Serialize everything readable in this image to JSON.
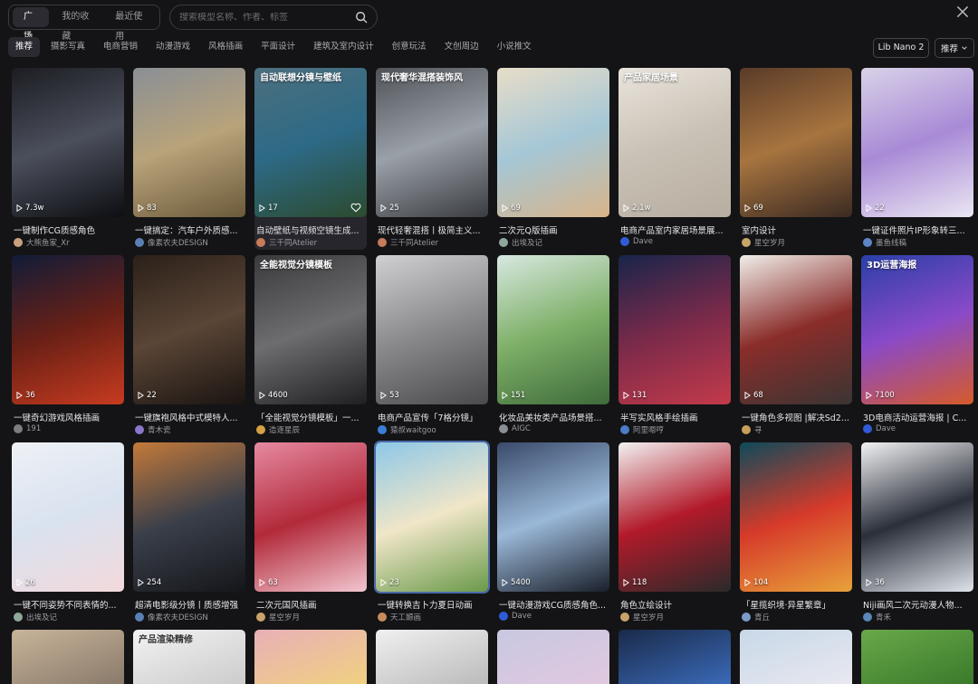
{
  "tabs": [
    {
      "label": "广场",
      "active": true
    },
    {
      "label": "我的收藏",
      "active": false
    },
    {
      "label": "最近使用",
      "active": false
    }
  ],
  "search": {
    "placeholder": "搜索模型名称、作者、标签"
  },
  "categories": [
    {
      "label": "推荐",
      "active": true
    },
    {
      "label": "摄影写真",
      "active": false
    },
    {
      "label": "电商营销",
      "active": false
    },
    {
      "label": "动漫游戏",
      "active": false
    },
    {
      "label": "风格插画",
      "active": false
    },
    {
      "label": "平面设计",
      "active": false
    },
    {
      "label": "建筑及室内设计",
      "active": false
    },
    {
      "label": "创意玩法",
      "active": false
    },
    {
      "label": "文创周边",
      "active": false
    },
    {
      "label": "小说推文",
      "active": false
    }
  ],
  "model_select": {
    "label": "Lib Nano 2"
  },
  "sort_select": {
    "label": "推荐"
  },
  "cards": [
    {
      "title": "一键制作CG质感角色",
      "author": "大熊鱼家_Xr",
      "plays": "7.3w",
      "colors": [
        "#1c1d22",
        "#4b4f5c",
        "#0d0e12"
      ],
      "avatar": "#c9a27c",
      "overlay": ""
    },
    {
      "title": "一键搞定：汽车户外质感...",
      "author": "像素农夫DESIGN",
      "plays": "83",
      "colors": [
        "#8a8f96",
        "#b8a37a",
        "#6b5a3a"
      ],
      "avatar": "#5a7fb5",
      "overlay": ""
    },
    {
      "title": "自动壁纸与视频空镜生成...",
      "author": "三千同Atelier",
      "plays": "17",
      "colors": [
        "#4d6f7e",
        "#2d6a86",
        "#2c4a2e"
      ],
      "avatar": "#c77b58",
      "overlay": "自动联想分镜与壁纸",
      "hover": true
    },
    {
      "title": "现代轻奢混搭丨极简主义...",
      "author": "三千同Atelier",
      "plays": "25",
      "colors": [
        "#4f5358",
        "#9aa0a8",
        "#3a3c40"
      ],
      "avatar": "#c77b58",
      "overlay": "现代奢华混搭装饰风"
    },
    {
      "title": "二次元Q版插画",
      "author": "出埃及记",
      "plays": "69",
      "colors": [
        "#e8ddc8",
        "#a5c7d6",
        "#d8b48a"
      ],
      "avatar": "#8fa89a",
      "overlay": ""
    },
    {
      "title": "电商产品室内家居场景展...",
      "author": "Dave",
      "plays": "2.1w",
      "colors": [
        "#e9e4dc",
        "#c9c1b5",
        "#b7aea1"
      ],
      "avatar": "#2f5bd6",
      "overlay": "产品家居场景"
    },
    {
      "title": "室内设计",
      "author": "星空岁月",
      "plays": "69",
      "colors": [
        "#5a3b28",
        "#a7743f",
        "#3b2a22"
      ],
      "avatar": "#c9a46a",
      "overlay": ""
    },
    {
      "title": "一键证件照片IP形象转三...",
      "author": "墨鱼线稿",
      "plays": "22",
      "colors": [
        "#d9d2e8",
        "#a88ad6",
        "#ebe6f2"
      ],
      "avatar": "#5c86c4",
      "overlay": ""
    },
    {
      "title": "一键奇幻游戏风格插画",
      "author": "191",
      "plays": "36",
      "colors": [
        "#101c38",
        "#6a2016",
        "#c73b1f"
      ],
      "avatar": "#7d7d7d",
      "overlay": ""
    },
    {
      "title": "一键旗袍风格中式模特人...",
      "author": "青木瓷",
      "plays": "22",
      "colors": [
        "#2b2019",
        "#5a4536",
        "#1a1411"
      ],
      "avatar": "#8c76c9",
      "overlay": ""
    },
    {
      "title": "「全能视觉分镜模板」一...",
      "author": "造逐星辰",
      "plays": "4600",
      "colors": [
        "#3a3a3c",
        "#6d6d70",
        "#1f1f21"
      ],
      "avatar": "#d6a045",
      "overlay": "全能视觉分镜模板"
    },
    {
      "title": "电商产品宣传「7格分镜」",
      "author": "猿叔waitgoo",
      "plays": "53",
      "colors": [
        "#d0d0d2",
        "#8a8a8c",
        "#4a4a4c"
      ],
      "avatar": "#3b7ed6",
      "overlay": ""
    },
    {
      "title": "化妆品美妆类产品场景搭...",
      "author": "AIGC",
      "plays": "151",
      "colors": [
        "#d7e8e0",
        "#7fb069",
        "#3e6b3a"
      ],
      "avatar": "#8a8f96",
      "overlay": ""
    },
    {
      "title": "半写实风格手绘插画",
      "author": "阿里嗯哼",
      "plays": "131",
      "colors": [
        "#18254a",
        "#7b2a4a",
        "#c33a4a"
      ],
      "avatar": "#4a7cc8",
      "overlay": ""
    },
    {
      "title": "一键角色多视图 |解决Sd2...",
      "author": "寻",
      "plays": "68",
      "colors": [
        "#f0eeea",
        "#8a2d2a",
        "#3a3533"
      ],
      "avatar": "#c99e5a",
      "overlay": ""
    },
    {
      "title": "3D电商活动运营海报 | C...",
      "author": "Dave",
      "plays": "7100",
      "colors": [
        "#2a3fa8",
        "#8a4ac8",
        "#d65a2a"
      ],
      "avatar": "#2f5bd6",
      "overlay": "3D运营海报"
    },
    {
      "title": "一键不同姿势不同表情的...",
      "author": "出埃及记",
      "plays": "26",
      "colors": [
        "#eef1f6",
        "#d9e2ef",
        "#f3d9dc"
      ],
      "avatar": "#8fa89a",
      "overlay": ""
    },
    {
      "title": "超清电影级分镜丨质感增强",
      "author": "像素农夫DESIGN",
      "plays": "254",
      "colors": [
        "#c47a3a",
        "#3a3f4a",
        "#15161a"
      ],
      "avatar": "#5a7fb5",
      "overlay": ""
    },
    {
      "title": "二次元国风插画",
      "author": "星空岁月",
      "plays": "63",
      "colors": [
        "#e68aa2",
        "#b22a3a",
        "#f2c6d0"
      ],
      "avatar": "#c9a46a",
      "overlay": ""
    },
    {
      "title": "一键转换吉卜力夏日动画",
      "author": "天工嫄画",
      "plays": "23",
      "colors": [
        "#8ec8e8",
        "#f0e6c8",
        "#6a9a4a"
      ],
      "avatar": "#c98a5a",
      "overlay": "",
      "selected": true
    },
    {
      "title": "一键动漫游戏CG质感角色...",
      "author": "Dave",
      "plays": "5400",
      "colors": [
        "#3a4a6a",
        "#9ab8d8",
        "#1a1f2a"
      ],
      "avatar": "#2f5bd6",
      "overlay": ""
    },
    {
      "title": "角色立绘设计",
      "author": "星空岁月",
      "plays": "118",
      "colors": [
        "#f2f2f2",
        "#b21a2a",
        "#2a2a2a"
      ],
      "avatar": "#c9a46a",
      "overlay": ""
    },
    {
      "title": "「星揽织境·异星繁章」",
      "author": "青丘",
      "plays": "104",
      "colors": [
        "#0e4a5a",
        "#d63a2a",
        "#e8a23a"
      ],
      "avatar": "#7a9ac8",
      "overlay": ""
    },
    {
      "title": "Niji画风二次元动漫人物...",
      "author": "青禾",
      "plays": "36",
      "colors": [
        "#f2f2f4",
        "#2a2f3a",
        "#dfe3ea"
      ],
      "avatar": "#5a86b8",
      "overlay": ""
    },
    {
      "colors": [
        "#c7b49a",
        "#8a7a6a"
      ]
    },
    {
      "colors": [
        "#f2f2f2",
        "#cccccc"
      ],
      "overlay": "产品渲染精修"
    },
    {
      "colors": [
        "#e8b0b8",
        "#f0d080"
      ]
    },
    {
      "colors": [
        "#f0f0f0",
        "#bbbbbb"
      ]
    },
    {
      "colors": [
        "#c8c8e0",
        "#e0c8e0"
      ]
    },
    {
      "colors": [
        "#1a2a4a",
        "#3a6ab8"
      ]
    },
    {
      "colors": [
        "#c8d8e8",
        "#e8e8f0"
      ]
    },
    {
      "colors": [
        "#6aa84a",
        "#3a7a2a"
      ]
    }
  ]
}
